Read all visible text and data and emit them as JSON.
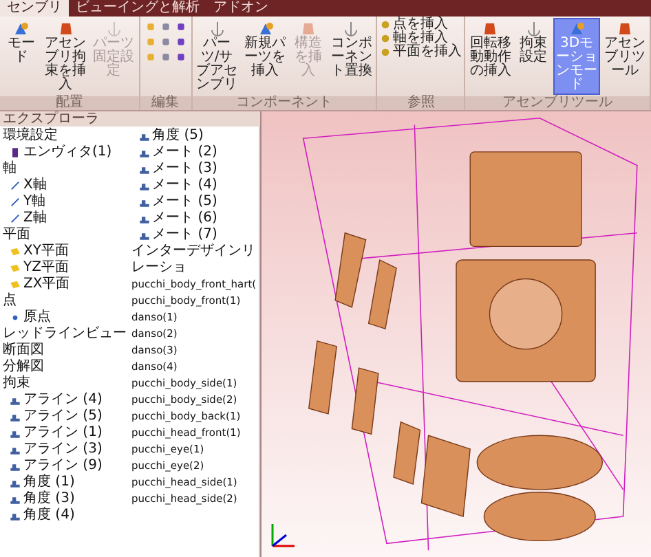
{
  "tabs": [
    {
      "label": "センブリ",
      "selected": true
    },
    {
      "label": "ビューイングと解析",
      "selected": false
    },
    {
      "label": "アドオン",
      "selected": false
    }
  ],
  "ribbon": [
    {
      "label": "配置",
      "buttons": [
        {
          "kind": "large",
          "label": "モード",
          "disabled": false,
          "selected": false
        },
        {
          "kind": "large",
          "label": "アセンブリ拘束を挿入",
          "disabled": false,
          "selected": false
        },
        {
          "kind": "large",
          "label": "パーツ固定設定",
          "disabled": true,
          "selected": false
        }
      ]
    },
    {
      "label": "編集",
      "buttons": [
        {
          "kind": "grid"
        }
      ]
    },
    {
      "label": "コンポーネント",
      "buttons": [
        {
          "kind": "large",
          "label": "パーツ/サブアセンブリ",
          "disabled": false,
          "selected": false
        },
        {
          "kind": "large",
          "label": "新規パーツを挿入",
          "disabled": false,
          "selected": false
        },
        {
          "kind": "large",
          "label": "構造を挿入",
          "disabled": true,
          "selected": false
        },
        {
          "kind": "large",
          "label": "コンポーネント置換",
          "disabled": false,
          "selected": false
        }
      ]
    },
    {
      "label": "参照",
      "buttons": [
        {
          "kind": "stack",
          "items": [
            "点を挿入",
            "軸を挿入",
            "平面を挿入"
          ]
        }
      ]
    },
    {
      "label": "アセンブリツール",
      "buttons": [
        {
          "kind": "large",
          "label": "回転移動動作の挿入",
          "disabled": false,
          "selected": false
        },
        {
          "kind": "large",
          "label": "拘束設定",
          "disabled": false,
          "selected": false
        },
        {
          "kind": "large",
          "label": "3Dモーションモード",
          "disabled": false,
          "selected": true
        },
        {
          "kind": "large",
          "label": "アセンブリツール",
          "disabled": false,
          "selected": false
        }
      ]
    }
  ],
  "explorer": {
    "title": "エクスプローラ",
    "items": [
      {
        "kind": "group",
        "text": "環境設定"
      },
      {
        "kind": "component",
        "text": "エンヴィタ(1)"
      },
      {
        "kind": "group",
        "text": "軸"
      },
      {
        "kind": "axis",
        "text": "X軸"
      },
      {
        "kind": "axis",
        "text": "Y軸"
      },
      {
        "kind": "axis",
        "text": "Z軸"
      },
      {
        "kind": "group",
        "text": "平面"
      },
      {
        "kind": "plane",
        "text": "XY平面"
      },
      {
        "kind": "plane",
        "text": "YZ平面"
      },
      {
        "kind": "plane",
        "text": "ZX平面"
      },
      {
        "kind": "group",
        "text": "点"
      },
      {
        "kind": "point",
        "text": "原点"
      },
      {
        "kind": "group",
        "text": "レッドラインビュー"
      },
      {
        "kind": "group",
        "text": "断面図"
      },
      {
        "kind": "group",
        "text": "分解図"
      },
      {
        "kind": "group",
        "text": "拘束"
      },
      {
        "kind": "constraint",
        "text": "アライン (4)"
      },
      {
        "kind": "constraint",
        "text": "アライン (5)"
      },
      {
        "kind": "constraint",
        "text": "アライン (1)"
      },
      {
        "kind": "constraint",
        "text": "アライン (3)"
      },
      {
        "kind": "constraint",
        "text": "アライン (9)"
      },
      {
        "kind": "constraint",
        "text": "角度 (1)"
      },
      {
        "kind": "constraint",
        "text": "角度 (3)"
      },
      {
        "kind": "constraint",
        "text": "角度 (4)"
      },
      {
        "kind": "constraint",
        "text": "角度 (5)"
      },
      {
        "kind": "constraint",
        "text": "メート (2)"
      },
      {
        "kind": "constraint",
        "text": "メート (3)"
      },
      {
        "kind": "constraint",
        "text": "メート (4)"
      },
      {
        "kind": "constraint",
        "text": "メート (5)"
      },
      {
        "kind": "constraint",
        "text": "メート (6)"
      },
      {
        "kind": "constraint",
        "text": "メート (7)"
      },
      {
        "kind": "group",
        "text": "インターデザインリレーショ"
      },
      {
        "kind": "part",
        "text": "pucchi_body_front_hart("
      },
      {
        "kind": "part",
        "text": "pucchi_body_front(1)"
      },
      {
        "kind": "part",
        "text": "danso(1)"
      },
      {
        "kind": "part",
        "text": "danso(2)"
      },
      {
        "kind": "part",
        "text": "danso(3)"
      },
      {
        "kind": "part",
        "text": "danso(4)"
      },
      {
        "kind": "part",
        "text": "pucchi_body_side(1)"
      },
      {
        "kind": "part",
        "text": "pucchi_body_side(2)"
      },
      {
        "kind": "part",
        "text": "pucchi_body_back(1)"
      },
      {
        "kind": "part",
        "text": "pucchi_head_front(1)"
      },
      {
        "kind": "part",
        "text": "pucchi_eye(1)"
      },
      {
        "kind": "part",
        "text": "pucchi_eye(2)"
      },
      {
        "kind": "part",
        "text": "pucchi_head_side(1)"
      },
      {
        "kind": "part",
        "text": "pucchi_head_side(2)"
      }
    ]
  }
}
